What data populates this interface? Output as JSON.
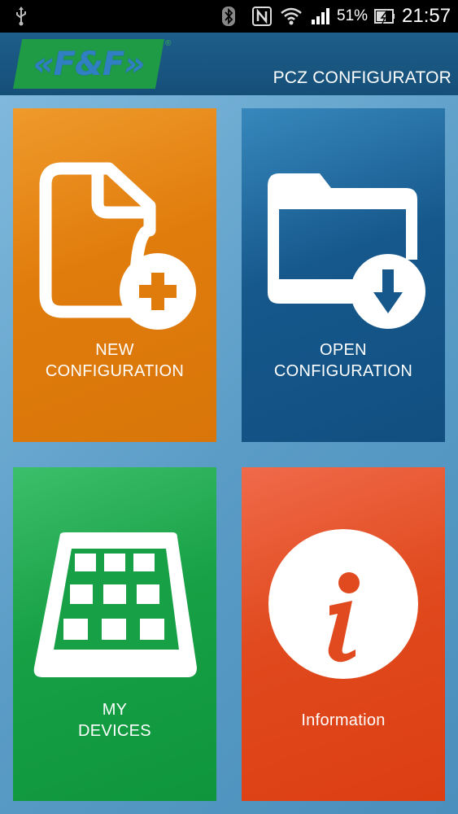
{
  "status_bar": {
    "battery_percent": "51%",
    "time": "21:57",
    "icons": [
      "usb-icon",
      "bluetooth-icon",
      "nfc-icon",
      "wifi-icon",
      "signal-icon",
      "battery-icon"
    ]
  },
  "header": {
    "logo_text": "«F&F»",
    "logo_reg": "®",
    "title": "PCZ CONFIGURATOR"
  },
  "tiles": [
    {
      "id": "new",
      "line1": "NEW",
      "line2": "CONFIGURATION",
      "color": "#e07c0c",
      "icon": "new-document-icon"
    },
    {
      "id": "open",
      "line1": "OPEN",
      "line2": "CONFIGURATION",
      "color": "#16588c",
      "icon": "open-folder-icon"
    },
    {
      "id": "devices",
      "line1": "MY",
      "line2": "DEVICES",
      "color": "#17a045",
      "icon": "device-grid-icon"
    },
    {
      "id": "info",
      "line1": "Information",
      "color": "#e04a1e",
      "icon": "info-icon"
    }
  ],
  "colors": {
    "header_bg": "#1d5e8a",
    "logo_green": "#1f9a45",
    "logo_blue": "#2f7fc2",
    "background": "#5b9fc7"
  }
}
